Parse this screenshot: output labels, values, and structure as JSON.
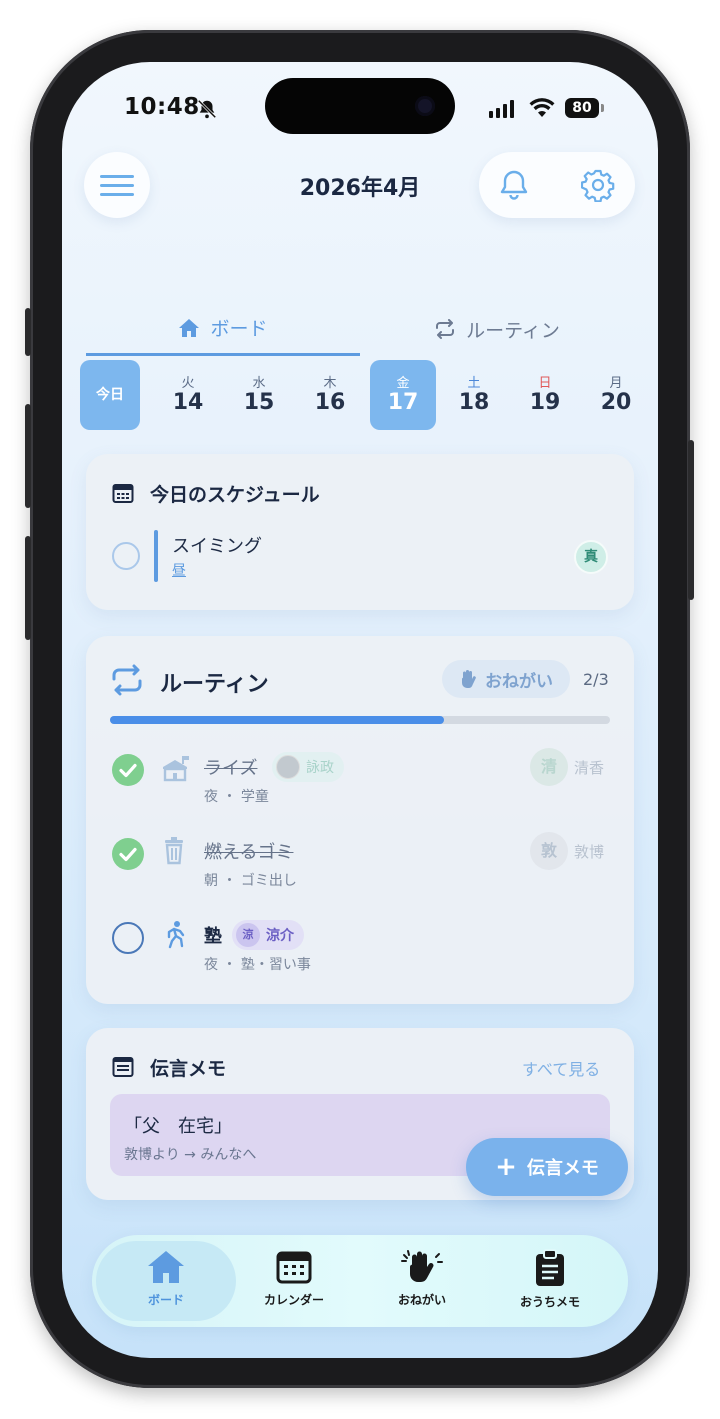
{
  "status_bar": {
    "time": "10:48",
    "battery": "80"
  },
  "header": {
    "title": "2026年4月"
  },
  "tabs": [
    {
      "label": "ボード",
      "active": true
    },
    {
      "label": "ルーティン",
      "active": false
    }
  ],
  "date_strip": {
    "today_label": "今日",
    "days": [
      {
        "dow": "火",
        "day": "14"
      },
      {
        "dow": "水",
        "day": "15"
      },
      {
        "dow": "木",
        "day": "16"
      },
      {
        "dow": "金",
        "day": "17",
        "selected": true
      },
      {
        "dow": "土",
        "day": "18"
      },
      {
        "dow": "日",
        "day": "19"
      },
      {
        "dow": "月",
        "day": "20"
      }
    ]
  },
  "schedule": {
    "title": "今日のスケジュール",
    "items": [
      {
        "name": "スイミング",
        "time": "昼",
        "badge": "真"
      }
    ]
  },
  "routine": {
    "title": "ルーティン",
    "onegai_label": "おねがい",
    "count": "2/3",
    "progress": 0.667,
    "items": [
      {
        "name": "ライズ",
        "sub": "夜 ・ 学童",
        "done": true,
        "chip": "詠政",
        "assignee_initial": "清",
        "assignee": "清香"
      },
      {
        "name": "燃えるゴミ",
        "sub": "朝 ・ ゴミ出し",
        "done": true,
        "assignee_initial": "敦",
        "assignee": "敦博"
      },
      {
        "name": "塾",
        "sub": "夜 ・ 塾・習い事",
        "done": false,
        "chip_initial": "涼",
        "chip": "涼介"
      }
    ]
  },
  "memo": {
    "title": "伝言メモ",
    "see_all": "すべて見る",
    "items": [
      {
        "text": "「父　在宅」",
        "from": "敦博より → みんなへ"
      }
    ]
  },
  "fab": {
    "label": "伝言メモ"
  },
  "tabbar": {
    "items": [
      {
        "label": "ボード",
        "active": true
      },
      {
        "label": "カレンダー"
      },
      {
        "label": "おねがい"
      },
      {
        "label": "おうちメモ"
      }
    ]
  },
  "colors": {
    "accent": "#5d9be0",
    "selected_day": "#7db7ee",
    "done": "#7fcf8f",
    "memo_bg": "#ddd6f1",
    "sunday": "#e05a5a",
    "saturday": "#4a86d8"
  }
}
